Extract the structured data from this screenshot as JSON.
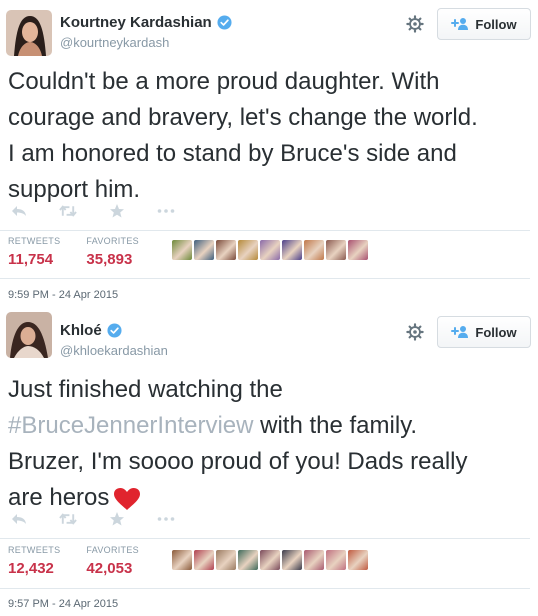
{
  "tweets": [
    {
      "name": "Kourtney Kardashian",
      "handle": "@kourtneykardash",
      "follow_label": "Follow",
      "text_line1": "Couldn't be a more proud daughter. With",
      "text_line2": "courage and bravery, let's change the world.",
      "text_line3": "I am honored to stand by Bruce's side and",
      "text_line4": "support him.",
      "retweets_label": "RETWEETS",
      "retweets_value": "11,754",
      "favorites_label": "FAVORITES",
      "favorites_value": "35,893",
      "timestamp": "9:59 PM - 24 Apr 2015",
      "face_colors": [
        "#6e8a3a",
        "#3f5f7e",
        "#7a4a3a",
        "#b58a3a",
        "#8a6aa8",
        "#4b3f8a",
        "#c0784a",
        "#8a5a50",
        "#a85070"
      ]
    },
    {
      "name": "Khloé",
      "handle": "@khloekardashian",
      "follow_label": "Follow",
      "text_line1": "Just finished watching the",
      "hashtag": "#BruceJennerInterview",
      "text_after_hashtag": " with the family.",
      "text_line3": "Bruzer, I'm soooo proud of you! Dads really",
      "text_line4": "are heros",
      "retweets_label": "RETWEETS",
      "retweets_value": "12,432",
      "favorites_label": "FAVORITES",
      "favorites_value": "42,053",
      "timestamp": "9:57 PM - 24 Apr 2015",
      "face_colors": [
        "#8a5a3a",
        "#b04050",
        "#9a7a60",
        "#3e6a5a",
        "#7a4a5a",
        "#3a3a4a",
        "#a85a70",
        "#c07080",
        "#c05a40"
      ]
    }
  ],
  "colors": {
    "accent": "#c8324a",
    "verified": "#55acee",
    "follow_icon": "#55acee",
    "heart": "#e0242e",
    "muted": "#8899a6"
  },
  "icons": {
    "reply": "reply-icon",
    "retweet": "retweet-icon",
    "favorite": "star-icon",
    "more": "more-icon"
  }
}
